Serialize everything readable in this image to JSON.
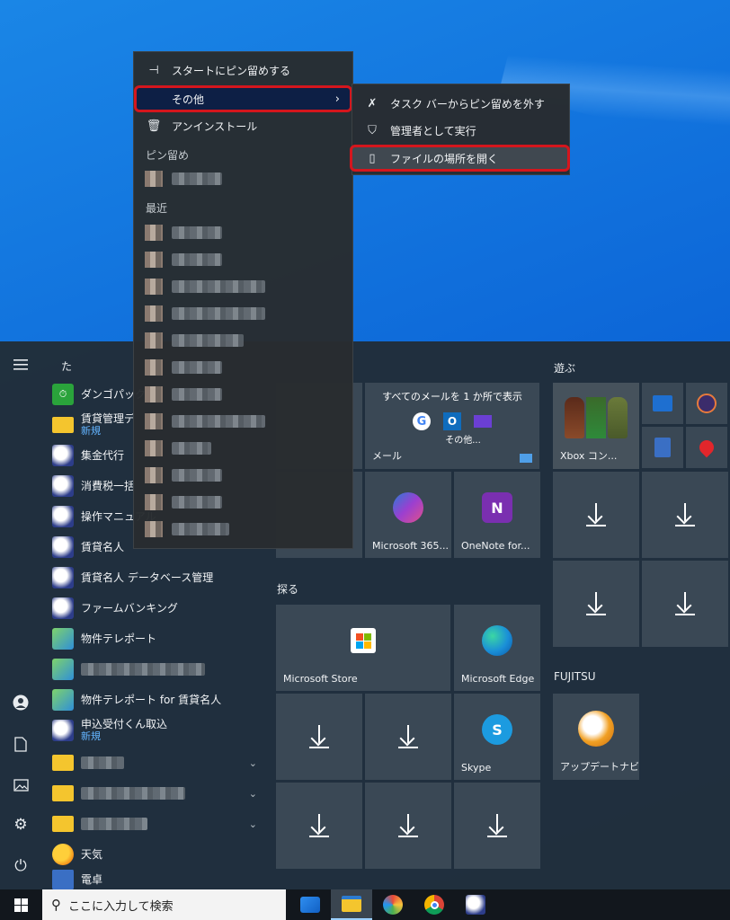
{
  "context_menu": {
    "pin_start": "スタートにピン留めする",
    "more": "その他",
    "uninstall": "アンインストール",
    "pinned_title": "ピン留め",
    "recent_title": "最近"
  },
  "submenu": {
    "unpin_taskbar": "タスク バーからピン留めを外す",
    "run_admin": "管理者として実行",
    "open_location": "ファイルの場所を開く"
  },
  "app_list": {
    "letter": "た",
    "items": [
      {
        "name": "ダンゴパックア",
        "sub": ""
      },
      {
        "name": "賃貸管理デ",
        "sub": "新規"
      },
      {
        "name": "集金代行",
        "sub": ""
      },
      {
        "name": "消費税一括",
        "sub": ""
      },
      {
        "name": "操作マニュアル",
        "sub": ""
      },
      {
        "name": "賃貸名人",
        "sub": ""
      },
      {
        "name": "賃貸名人 データベース管理",
        "sub": ""
      },
      {
        "name": "ファームバンキング",
        "sub": ""
      },
      {
        "name": "物件テレポート",
        "sub": ""
      },
      {
        "name": "物件テレポート for 賃貸名人",
        "sub": ""
      },
      {
        "name": "申込受付くん取込",
        "sub": "新規"
      },
      {
        "name": "天気",
        "sub": ""
      },
      {
        "name": "電卓",
        "sub": ""
      }
    ]
  },
  "tiles": {
    "mail_header": "すべてのメールを 1 か所で表示",
    "mail_more": "その他...",
    "mail": "メール",
    "m365": "Microsoft 365...",
    "onenote": "OneNote for...",
    "explore_title": "探る",
    "store": "Microsoft Store",
    "edge": "Microsoft Edge",
    "skype": "Skype",
    "play_title": "遊ぶ",
    "xbox": "Xbox コン...",
    "fujitsu_title": "FUJITSU",
    "update_navi": "アップデートナビ"
  },
  "taskbar": {
    "search_placeholder": "ここに入力して検索"
  }
}
